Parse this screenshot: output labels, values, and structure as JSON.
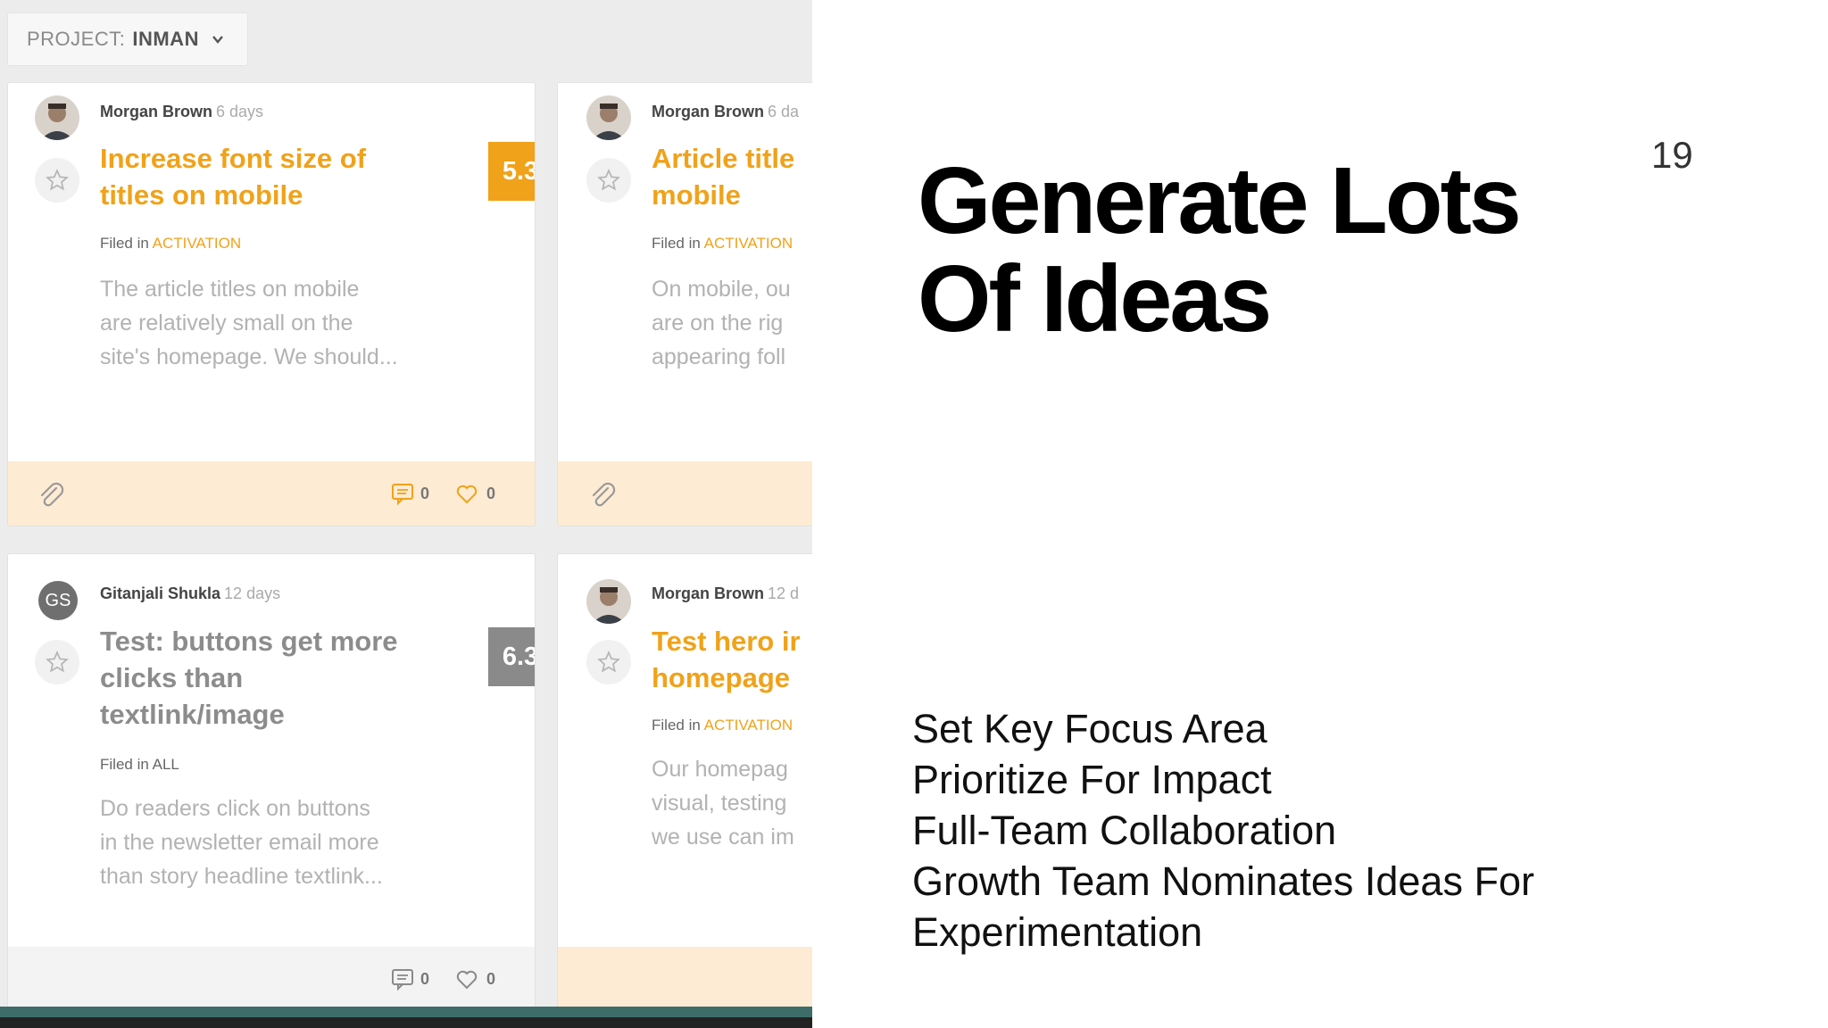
{
  "screenshot": {
    "project_label": "PROJECT:",
    "project_name": "INMAN",
    "cards": [
      {
        "author": "Morgan Brown",
        "age": "6 days",
        "title_lines": [
          "Increase font size of",
          "titles on mobile"
        ],
        "score": "5.3",
        "filed_prefix": "Filed in",
        "category": "ACTIVATION",
        "description_lines": [
          "The article titles on mobile",
          "are relatively small on the",
          "site's homepage. We should..."
        ],
        "comments": "0",
        "likes": "0"
      },
      {
        "author": "Morgan Brown",
        "age": "6 da",
        "title_lines": [
          "Article title",
          "mobile"
        ],
        "filed_prefix": "Filed in",
        "category": "ACTIVATION",
        "description_lines": [
          "On mobile, ou",
          "are on the rig",
          "appearing foll"
        ]
      },
      {
        "author": "Gitanjali Shukla",
        "avatar_initials": "GS",
        "age": "12 days",
        "title_lines": [
          "Test: buttons get more",
          "clicks than",
          "textlink/image"
        ],
        "score": "6.3",
        "filed_prefix": "Filed in",
        "category": "ALL",
        "description_lines": [
          "Do readers click on buttons",
          "in the newsletter email more",
          "than story headline textlink..."
        ],
        "comments": "0",
        "likes": "0"
      },
      {
        "author": "Morgan Brown",
        "age": "12 d",
        "title_lines": [
          "Test hero ir",
          "homepage"
        ],
        "filed_prefix": "Filed in",
        "category": "ACTIVATION",
        "description_lines": [
          "Our homepag",
          "visual, testing",
          "we use can im"
        ]
      }
    ]
  },
  "slide": {
    "page_number": "19",
    "title_lines": [
      "Generate Lots",
      "Of Ideas"
    ],
    "bullets": [
      "Set Key Focus Area",
      "Prioritize For Impact",
      "Full-Team Collaboration",
      "Growth Team Nominates Ideas For",
      "Experimentation"
    ]
  },
  "colors": {
    "accent_orange": "#f0a21a",
    "score_gray": "#8a8a8a",
    "footer_peach": "#fdebd3",
    "footer_gray": "#f3f3f3",
    "strip_teal": "#3e6d69"
  },
  "icons": [
    "chevron-down-icon",
    "star-icon",
    "paperclip-icon",
    "comment-icon",
    "heart-icon",
    "person-avatar-icon"
  ]
}
